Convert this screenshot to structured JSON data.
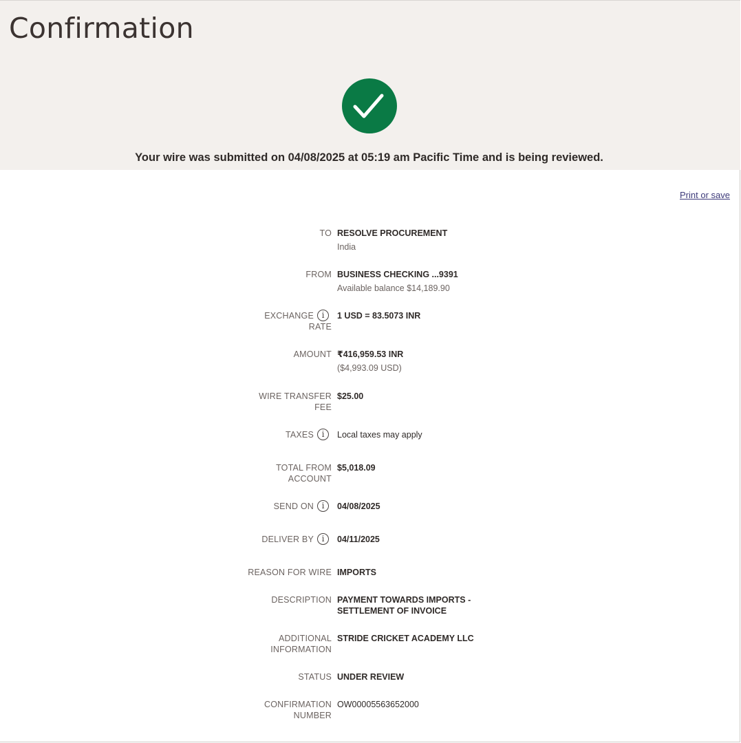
{
  "page": {
    "title": "Confirmation",
    "submitted_message": "Your wire was submitted on 04/08/2025 at 05:19 am Pacific Time and is being reviewed.",
    "print_link": "Print or save",
    "success_icon": "checkmark-icon",
    "success_color": "#0a7a45"
  },
  "details": {
    "to": {
      "label": "TO",
      "value": "RESOLVE PROCUREMENT",
      "sub": "India"
    },
    "from": {
      "label": "FROM",
      "value": "BUSINESS CHECKING ...9391",
      "sub": "Available balance $14,189.90"
    },
    "exchange_rate": {
      "label_line1": "EXCHANGE",
      "label_line2": "RATE",
      "value": "1 USD = 83.5073 INR"
    },
    "amount": {
      "label": "AMOUNT",
      "value": "₹416,959.53 INR",
      "sub": "($4,993.09 USD)"
    },
    "wire_fee": {
      "label_line1": "WIRE TRANSFER",
      "label_line2": "FEE",
      "value": "$25.00"
    },
    "taxes": {
      "label": "TAXES",
      "value": "Local taxes may apply"
    },
    "total": {
      "label_line1": "TOTAL FROM",
      "label_line2": "ACCOUNT",
      "value": "$5,018.09"
    },
    "send_on": {
      "label": "SEND ON",
      "value": "04/08/2025"
    },
    "deliver_by": {
      "label": "DELIVER BY",
      "value": "04/11/2025"
    },
    "reason": {
      "label": "REASON FOR WIRE",
      "value": "IMPORTS"
    },
    "description": {
      "label": "DESCRIPTION",
      "value_line1": "PAYMENT TOWARDS IMPORTS -",
      "value_line2": "SETTLEMENT OF INVOICE"
    },
    "additional": {
      "label_line1": "ADDITIONAL",
      "label_line2": "INFORMATION",
      "value": "STRIDE CRICKET ACADEMY LLC"
    },
    "status": {
      "label": "STATUS",
      "value": "UNDER REVIEW"
    },
    "confirmation": {
      "label_line1": "CONFIRMATION",
      "label_line2": "NUMBER",
      "value": "OW00005563652000"
    }
  }
}
